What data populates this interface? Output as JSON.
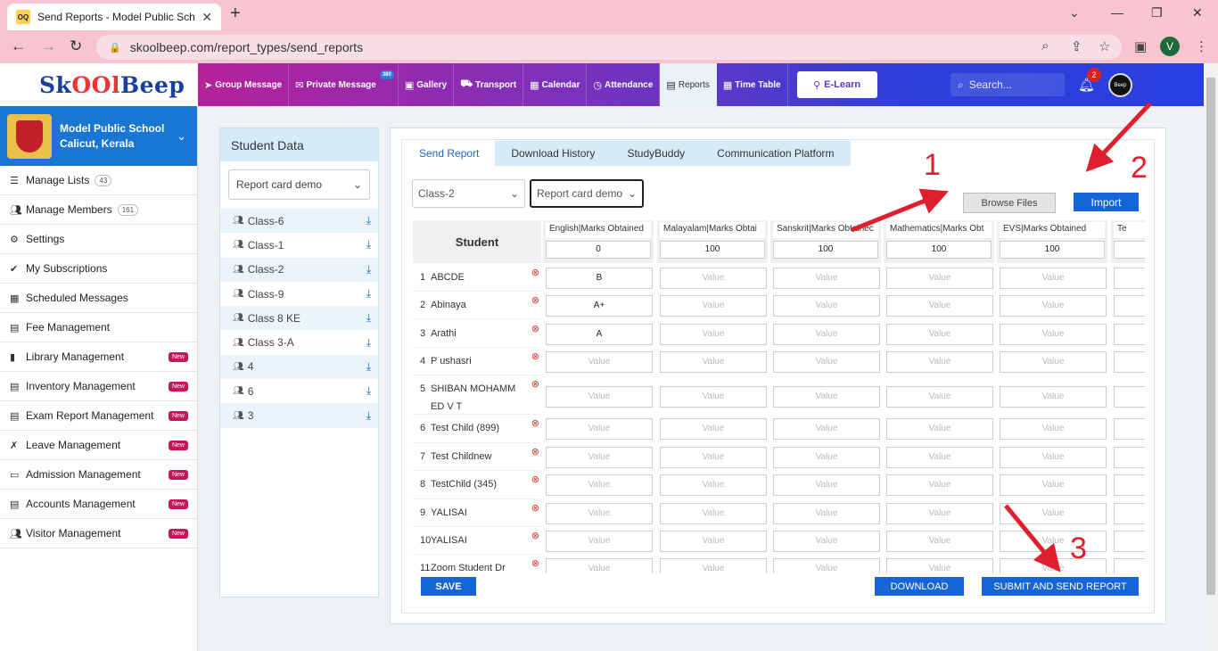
{
  "browser": {
    "tab_title": "Send Reports - Model Public Sch",
    "favicon_text": "OQ",
    "url": "skoolbeep.com/report_types/send_reports",
    "profile_letter": "V"
  },
  "app": {
    "logo_part1": "Sk",
    "logo_part2": "OOl",
    "logo_part3": "Beep",
    "nav": [
      {
        "label": "Group Message",
        "icon": "paper-plane-icon"
      },
      {
        "label": "Private Message",
        "icon": "envelope-icon",
        "badge": "380"
      },
      {
        "label": "Gallery",
        "icon": "image-icon"
      },
      {
        "label": "Transport",
        "icon": "bus-icon"
      },
      {
        "label": "Calendar",
        "icon": "calendar-icon"
      },
      {
        "label": "Attendance",
        "icon": "clock-icon"
      },
      {
        "label": "Reports",
        "icon": "file-icon"
      },
      {
        "label": "Time Table",
        "icon": "calendar-icon"
      }
    ],
    "elearn": "E-Learn",
    "search_placeholder": "Search...",
    "notification_count": "2",
    "profile_text": "Beep"
  },
  "sidebar": {
    "school_name": "Model Public School",
    "school_location": "Calicut, Kerala",
    "items": [
      {
        "label": "Manage Lists",
        "count": "43"
      },
      {
        "label": "Manage Members",
        "count": "161"
      },
      {
        "label": "Settings"
      },
      {
        "label": "My Subscriptions"
      },
      {
        "label": "Scheduled Messages"
      },
      {
        "label": "Fee Management"
      },
      {
        "label": "Library Management",
        "badge": "New"
      },
      {
        "label": "Inventory Management",
        "badge": "New"
      },
      {
        "label": "Exam Report Management",
        "badge": "New"
      },
      {
        "label": "Leave Management",
        "badge": "New"
      },
      {
        "label": "Admission Management",
        "badge": "New"
      },
      {
        "label": "Accounts Management",
        "badge": "New"
      },
      {
        "label": "Visitor Management",
        "badge": "New"
      }
    ]
  },
  "student_data": {
    "title": "Student Data",
    "selected_report": "Report card demo",
    "classes": [
      "Class-6",
      "Class-1",
      "Class-2",
      "Class-9",
      "Class 8 KE",
      "Class 3-A",
      "4",
      "6",
      "3"
    ]
  },
  "report": {
    "tabs": [
      "Send Report",
      "Download History",
      "StudyBuddy",
      "Communication Platform"
    ],
    "class_select": "Class-2",
    "report_select": "Report card demo",
    "browse_label": "Browse Files",
    "import_label": "Import",
    "student_header": "Student",
    "columns": [
      {
        "name": "English|Marks Obtained",
        "max": "0"
      },
      {
        "name": "Malayalam|Marks Obtai",
        "max": "100"
      },
      {
        "name": "Sanskrit|Marks Obtainec",
        "max": "100"
      },
      {
        "name": "Mathematics|Marks Obt",
        "max": "100"
      },
      {
        "name": "EVS|Marks Obtained",
        "max": "100"
      },
      {
        "name": "Te",
        "max": ""
      }
    ],
    "placeholder": "Value",
    "students": [
      {
        "no": "1",
        "name": "ABCDE",
        "english": "B"
      },
      {
        "no": "2",
        "name": "Abinaya",
        "english": "A+"
      },
      {
        "no": "3",
        "name": "Arathi",
        "english": "A"
      },
      {
        "no": "4",
        "name": "P ushasri",
        "english": ""
      },
      {
        "no": "5",
        "name": "SHIBAN MOHAMM ED V T",
        "english": ""
      },
      {
        "no": "6",
        "name": "Test Child (899)",
        "english": ""
      },
      {
        "no": "7",
        "name": "Test Childnew",
        "english": ""
      },
      {
        "no": "8",
        "name": "TestChild (345)",
        "english": ""
      },
      {
        "no": "9",
        "name": "YALISAI",
        "english": ""
      },
      {
        "no": "10",
        "name": "YALISAI",
        "english": ""
      },
      {
        "no": "11",
        "name": "Zoom Student Dr",
        "english": ""
      }
    ],
    "save_label": "SAVE",
    "download_label": "DOWNLOAD",
    "submit_label": "SUBMIT AND SEND REPORT"
  },
  "annotations": {
    "one": "1",
    "two": "2",
    "three": "3",
    "color": "#e01f2e"
  }
}
